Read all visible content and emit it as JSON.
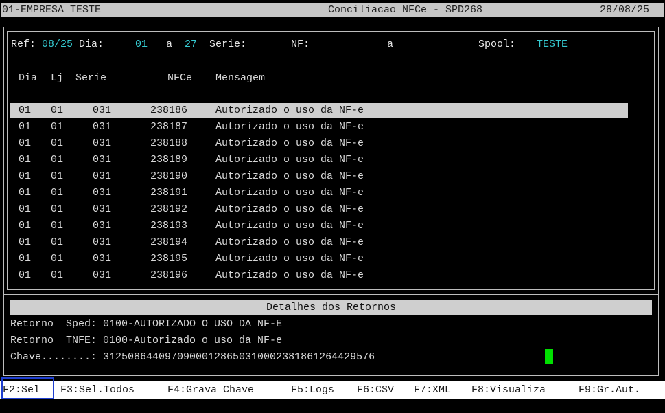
{
  "title_bar": {
    "company": "01-EMPRESA TESTE",
    "screen": "Conciliacao NFCe - SPD268",
    "date": "28/08/25"
  },
  "filters": {
    "ref_label": "Ref:",
    "ref_value": "08/25",
    "dia_label": "Dia:",
    "dia_from": "01",
    "dia_sep": "a",
    "dia_to": "27",
    "serie_label": "Serie:",
    "nf_label": "NF:",
    "nf_sep": "a",
    "spool_label": "Spool:",
    "spool_value": "TESTE"
  },
  "table": {
    "headers": {
      "dia": "Dia",
      "lj": "Lj",
      "serie": "Serie",
      "nfce": "NFCe",
      "mensagem": "Mensagem"
    },
    "rows": [
      {
        "dia": "01",
        "lj": "01",
        "serie": "031",
        "nfce": "238186",
        "mensagem": "Autorizado o uso da NF-e"
      },
      {
        "dia": "01",
        "lj": "01",
        "serie": "031",
        "nfce": "238187",
        "mensagem": "Autorizado o uso da NF-e"
      },
      {
        "dia": "01",
        "lj": "01",
        "serie": "031",
        "nfce": "238188",
        "mensagem": "Autorizado o uso da NF-e"
      },
      {
        "dia": "01",
        "lj": "01",
        "serie": "031",
        "nfce": "238189",
        "mensagem": "Autorizado o uso da NF-e"
      },
      {
        "dia": "01",
        "lj": "01",
        "serie": "031",
        "nfce": "238190",
        "mensagem": "Autorizado o uso da NF-e"
      },
      {
        "dia": "01",
        "lj": "01",
        "serie": "031",
        "nfce": "238191",
        "mensagem": "Autorizado o uso da NF-e"
      },
      {
        "dia": "01",
        "lj": "01",
        "serie": "031",
        "nfce": "238192",
        "mensagem": "Autorizado o uso da NF-e"
      },
      {
        "dia": "01",
        "lj": "01",
        "serie": "031",
        "nfce": "238193",
        "mensagem": "Autorizado o uso da NF-e"
      },
      {
        "dia": "01",
        "lj": "01",
        "serie": "031",
        "nfce": "238194",
        "mensagem": "Autorizado o uso da NF-e"
      },
      {
        "dia": "01",
        "lj": "01",
        "serie": "031",
        "nfce": "238195",
        "mensagem": "Autorizado o uso da NF-e"
      },
      {
        "dia": "01",
        "lj": "01",
        "serie": "031",
        "nfce": "238196",
        "mensagem": "Autorizado o uso da NF-e"
      }
    ]
  },
  "details": {
    "title": "Detalhes dos Retornos",
    "sped_line": "Retorno  Sped: 0100-AUTORIZADO O USO DA NF-E",
    "tnfe_line": "Retorno  TNFE: 0100-Autorizado o uso da NF-e",
    "chave_line": "Chave........: 31250864409709000128650310002381861264429576"
  },
  "function_keys": {
    "f2": "F2:Sel",
    "f3": "F3:Sel.Todos",
    "f4": "F4:Grava Chave",
    "f5": "F5:Logs",
    "f6": "F6:CSV",
    "f7": "F7:XML",
    "f8": "F8:Visualiza",
    "f9": "F9:Gr.Aut."
  },
  "colors": {
    "accent": "#35c9d0",
    "cursor": "#00e000",
    "selection": "#cfcfcf",
    "focus": "#1f3fd0"
  }
}
